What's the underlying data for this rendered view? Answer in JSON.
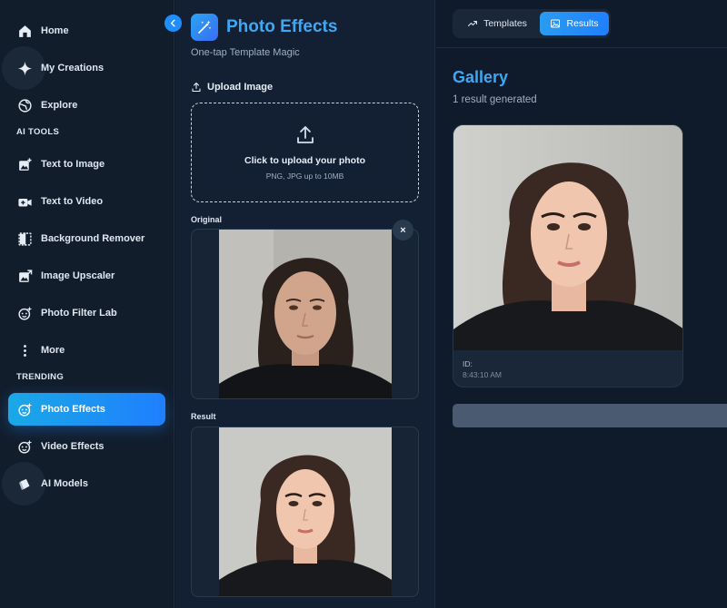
{
  "sidebar": {
    "items": [
      {
        "label": "Home",
        "icon": "home-icon"
      },
      {
        "label": "My Creations",
        "icon": "sparkle-icon"
      },
      {
        "label": "Explore",
        "icon": "globe-icon"
      },
      {
        "label": "Text to Image",
        "icon": "image-plus-icon"
      },
      {
        "label": "Text to Video",
        "icon": "video-plus-icon"
      },
      {
        "label": "Background Remover",
        "icon": "background-remover-icon"
      },
      {
        "label": "Image Upscaler",
        "icon": "image-upscale-icon"
      },
      {
        "label": "Photo Filter Lab",
        "icon": "face-sparkle-icon"
      },
      {
        "label": "More",
        "icon": "more-vertical-icon"
      },
      {
        "label": "Photo Effects",
        "icon": "face-sparkle-icon"
      },
      {
        "label": "Video Effects",
        "icon": "face-sparkle-icon"
      },
      {
        "label": "AI Models",
        "icon": "cube-icon"
      }
    ],
    "sections": {
      "ai_tools": "AI TOOLS",
      "trending": "TRENDING"
    },
    "active_item": "Photo Effects"
  },
  "header": {
    "title": "Photo Effects",
    "subtitle": "One-tap Template Magic"
  },
  "upload": {
    "label": "Upload Image",
    "prompt": "Click to upload your photo",
    "hint": "PNG, JPG up to 10MB"
  },
  "images": {
    "original_label": "Original",
    "result_label": "Result",
    "close_symbol": "×"
  },
  "tabs": [
    {
      "label": "Templates",
      "icon": "trend-icon"
    },
    {
      "label": "Results",
      "icon": "image-icon",
      "active": true
    }
  ],
  "gallery": {
    "title": "Gallery",
    "count_text": "1 result generated",
    "card": {
      "id_label": "ID:",
      "time": "8:43:10 AM"
    }
  },
  "colors": {
    "accent": "#3ea8f5",
    "active_gradient_start": "#1aa8e6",
    "active_gradient_end": "#1f7fff",
    "background": "#0f1a29"
  }
}
